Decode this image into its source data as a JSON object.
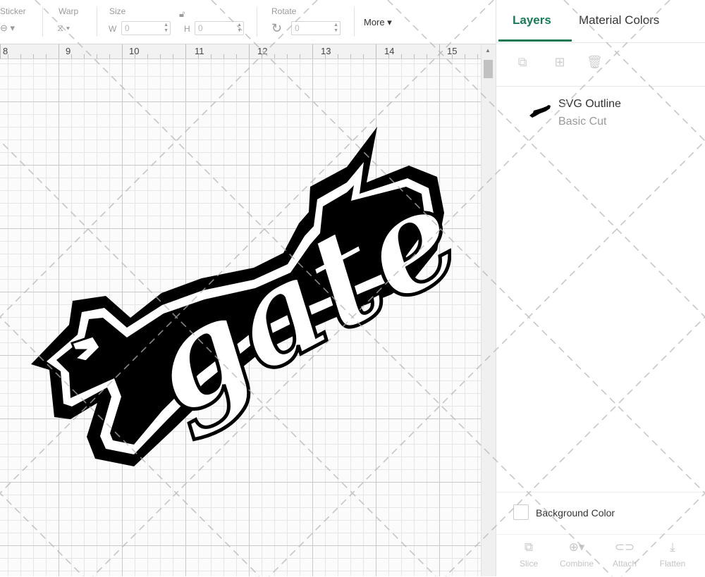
{
  "toolbar": {
    "sticker_label": "Sticker",
    "warp_label": "Warp",
    "size_label": "Size",
    "width_letter": "W",
    "width_value": "0",
    "height_letter": "H",
    "height_value": "0",
    "rotate_label": "Rotate",
    "rotate_value": "0",
    "more_label": "More"
  },
  "ruler": {
    "ticks": [
      "8",
      "9",
      "10",
      "11",
      "12",
      "13",
      "14",
      "15"
    ]
  },
  "panel": {
    "tabs": [
      "Layers",
      "Material Colors"
    ],
    "layer": {
      "name": "SVG Outline",
      "operation": "Basic Cut"
    },
    "background_color_label": "Background Color",
    "bottom_tools": [
      "Slice",
      "Combine",
      "Attach",
      "Flatten"
    ]
  },
  "design": {
    "text": "gate"
  },
  "colors": {
    "accent": "#1a7a55",
    "design_fill": "#000000"
  }
}
